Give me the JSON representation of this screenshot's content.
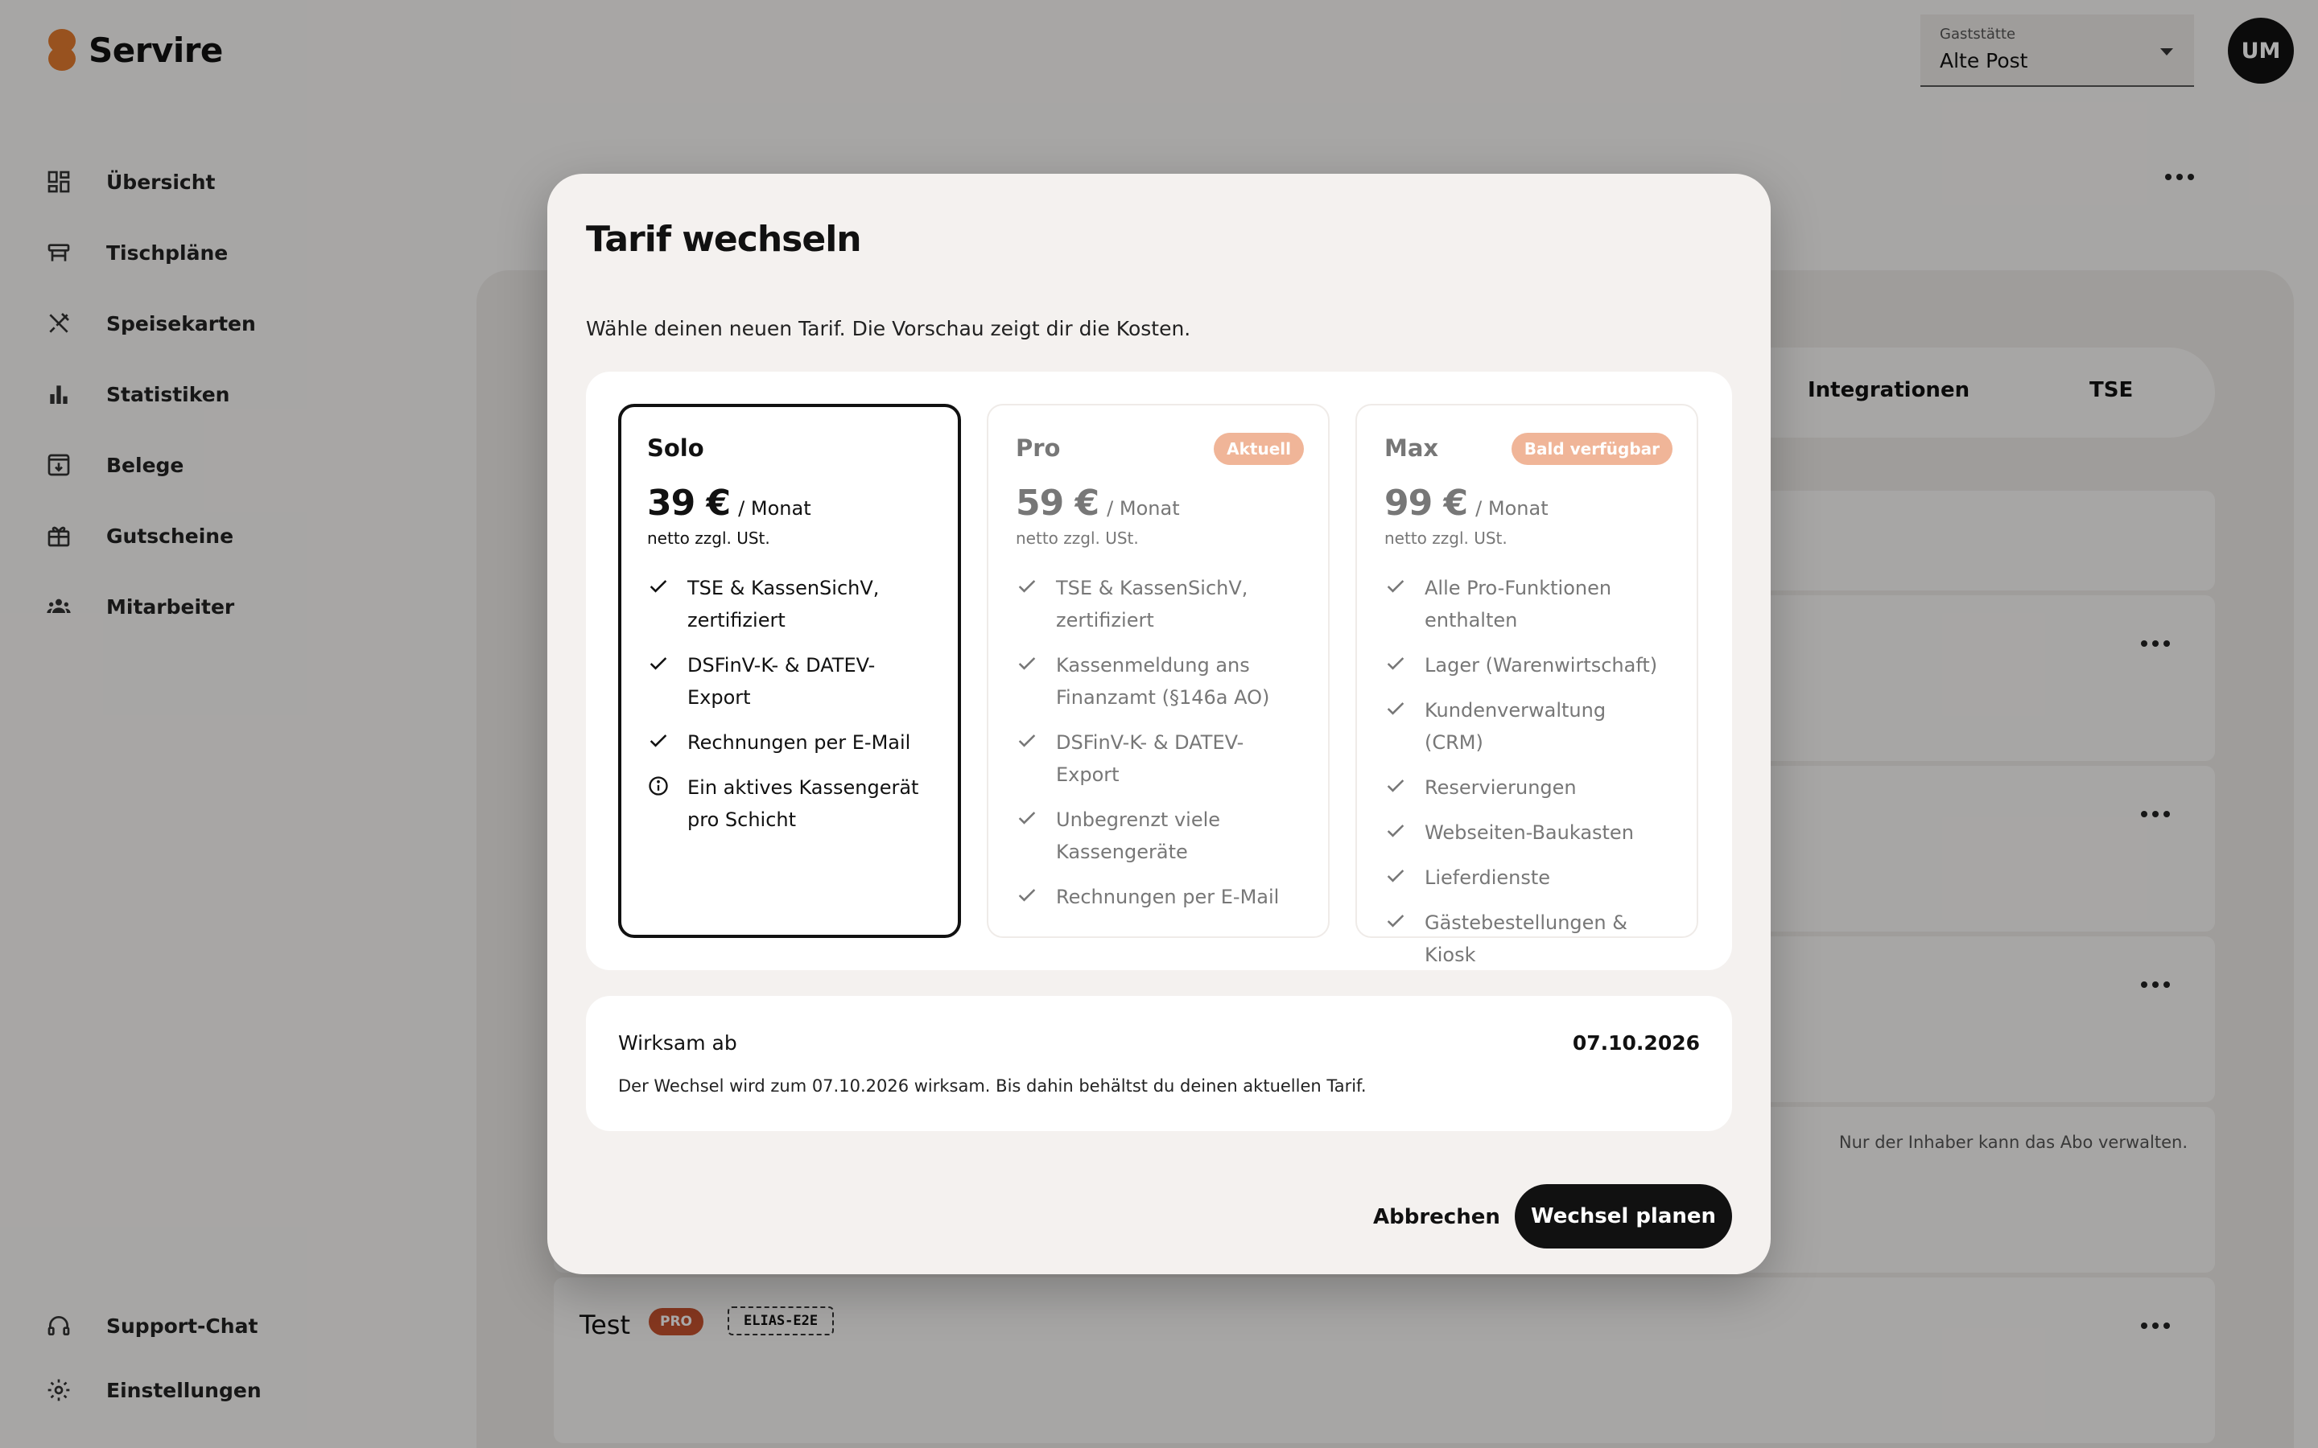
{
  "app": {
    "name": "Servire"
  },
  "sidebar": {
    "items": [
      {
        "label": "Übersicht",
        "icon": "dashboard-icon"
      },
      {
        "label": "Tischpläne",
        "icon": "table-icon"
      },
      {
        "label": "Speisekarten",
        "icon": "utensils-icon"
      },
      {
        "label": "Statistiken",
        "icon": "bar-chart-icon"
      },
      {
        "label": "Belege",
        "icon": "receipt-download-icon"
      },
      {
        "label": "Gutscheine",
        "icon": "gift-card-icon"
      },
      {
        "label": "Mitarbeiter",
        "icon": "team-icon"
      }
    ],
    "bottom_items": [
      {
        "label": "Support-Chat",
        "icon": "headset-icon"
      },
      {
        "label": "Einstellungen",
        "icon": "gear-icon"
      }
    ]
  },
  "header": {
    "location_select": {
      "label": "Gaststätte",
      "value": "Alte Post"
    },
    "avatar_initials": "UM"
  },
  "background": {
    "tabs": [
      "Integrationen",
      "TSE"
    ],
    "owner_note": "Nur der Inhaber kann das Abo verwalten.",
    "test_row": {
      "title": "Test",
      "badge": "PRO",
      "code": "ELIAS-E2E"
    }
  },
  "modal": {
    "title": "Tarif wechseln",
    "subtitle": "Wähle deinen neuen Tarif. Die Vorschau zeigt dir die Kosten.",
    "plans": [
      {
        "name": "Solo",
        "price": "39 €",
        "period": "/ Monat",
        "net_note": "netto zzgl. USt.",
        "badge": "",
        "selected": true,
        "features": [
          {
            "icon": "check-icon",
            "text": "TSE & KassenSichV, zertifiziert"
          },
          {
            "icon": "check-icon",
            "text": "DSFinV-K- & DATEV-Export"
          },
          {
            "icon": "check-icon",
            "text": "Rechnungen per E-Mail"
          },
          {
            "icon": "info-icon",
            "text": "Ein aktives Kassengerät pro Schicht"
          }
        ]
      },
      {
        "name": "Pro",
        "price": "59 €",
        "period": "/ Monat",
        "net_note": "netto zzgl. USt.",
        "badge": "Aktuell",
        "selected": false,
        "features": [
          {
            "icon": "check-icon",
            "text": "TSE & KassenSichV, zertifiziert"
          },
          {
            "icon": "check-icon",
            "text": "Kassenmeldung ans Finanzamt (§146a AO)"
          },
          {
            "icon": "check-icon",
            "text": "DSFinV-K- & DATEV-Export"
          },
          {
            "icon": "check-icon",
            "text": "Unbegrenzt viele Kassengeräte"
          },
          {
            "icon": "check-icon",
            "text": "Rechnungen per E-Mail"
          }
        ]
      },
      {
        "name": "Max",
        "price": "99 €",
        "period": "/ Monat",
        "net_note": "netto zzgl. USt.",
        "badge": "Bald verfügbar",
        "selected": false,
        "features": [
          {
            "icon": "check-icon",
            "text": "Alle Pro-Funktionen enthalten"
          },
          {
            "icon": "check-icon",
            "text": "Lager (Warenwirtschaft)"
          },
          {
            "icon": "check-icon",
            "text": "Kundenverwaltung (CRM)"
          },
          {
            "icon": "check-icon",
            "text": "Reservierungen"
          },
          {
            "icon": "check-icon",
            "text": "Webseiten-Baukasten"
          },
          {
            "icon": "check-icon",
            "text": "Lieferdienste"
          },
          {
            "icon": "check-icon",
            "text": "Gästebestellungen & Kiosk"
          }
        ]
      }
    ],
    "effective": {
      "label": "Wirksam ab",
      "date": "07.10.2026",
      "note": "Der Wechsel wird zum 07.10.2026 wirksam. Bis dahin behältst du deinen aktuellen Tarif."
    },
    "cancel_label": "Abbrechen",
    "confirm_label": "Wechsel planen"
  },
  "colors": {
    "brand": "#e07a2e",
    "badge_bg": "#f0b598",
    "pro_badge": "#c4522e",
    "primary_button": "#111111"
  }
}
